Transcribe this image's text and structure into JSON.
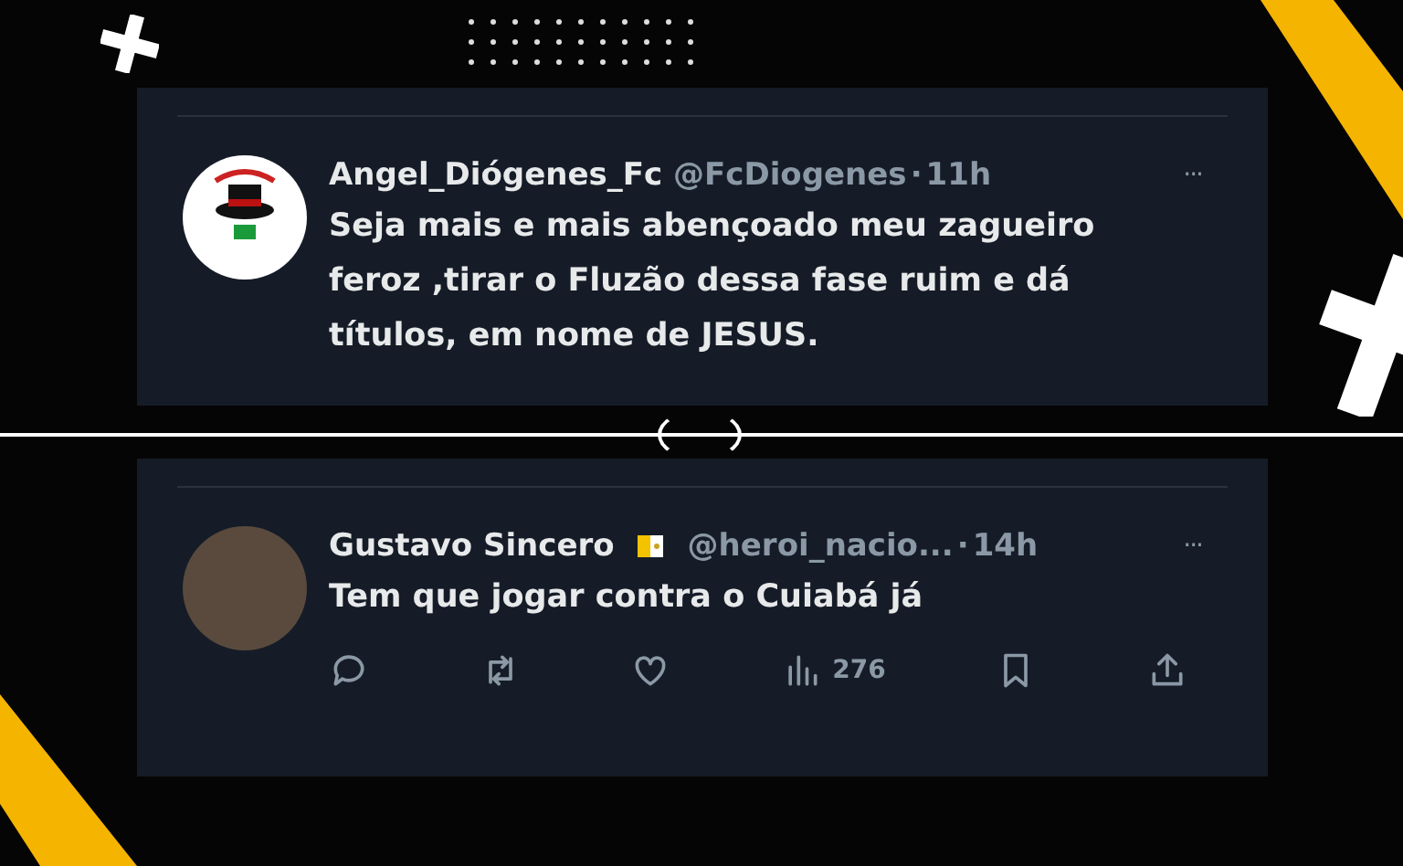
{
  "tweets": [
    {
      "display_name": "Angel_Diógenes_Fc",
      "has_flag": false,
      "handle": "@FcDiogenes",
      "separator": "·",
      "time": "11h",
      "more": "···",
      "avatar": {
        "kind": "logo"
      },
      "text": "Seja mais e mais abençoado meu zagueiro feroz ,tirar o Fluzão dessa fase ruim e dá títulos, em nome de JESUS."
    },
    {
      "display_name": "Gustavo Sincero",
      "has_flag": true,
      "handle": "@heroi_nacio...",
      "separator": "·",
      "time": "14h",
      "more": "···",
      "avatar": {
        "kind": "photo"
      },
      "text": "Tem que jogar contra o Cuiabá já",
      "actions": {
        "views": "276"
      }
    }
  ]
}
